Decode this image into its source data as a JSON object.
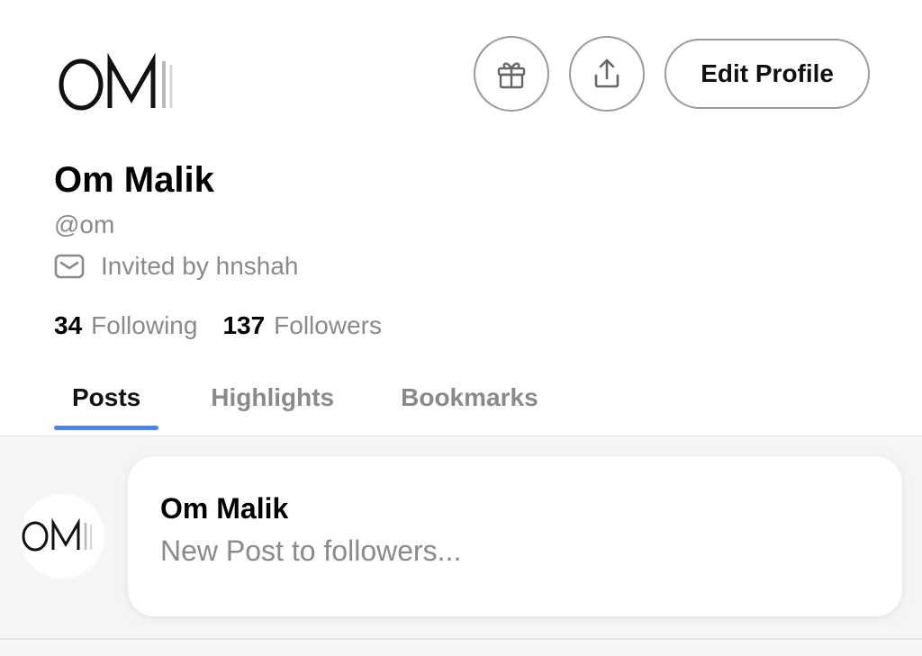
{
  "profile": {
    "name": "Om Malik",
    "handle": "@om",
    "invited_by": "Invited by hnshah",
    "following_count": "34",
    "following_label": "Following",
    "followers_count": "137",
    "followers_label": "Followers",
    "logo_text": "OM"
  },
  "actions": {
    "gift_icon": "gift-icon",
    "share_icon": "share-icon",
    "edit_label": "Edit Profile"
  },
  "tabs": [
    {
      "label": "Posts",
      "active": true
    },
    {
      "label": "Highlights",
      "active": false
    },
    {
      "label": "Bookmarks",
      "active": false
    }
  ],
  "composer": {
    "author": "Om Malik",
    "placeholder": "New Post to followers..."
  },
  "colors": {
    "accent": "#4a86e8",
    "muted_text": "#8a8a8a",
    "feed_bg": "#f5f5f7"
  }
}
